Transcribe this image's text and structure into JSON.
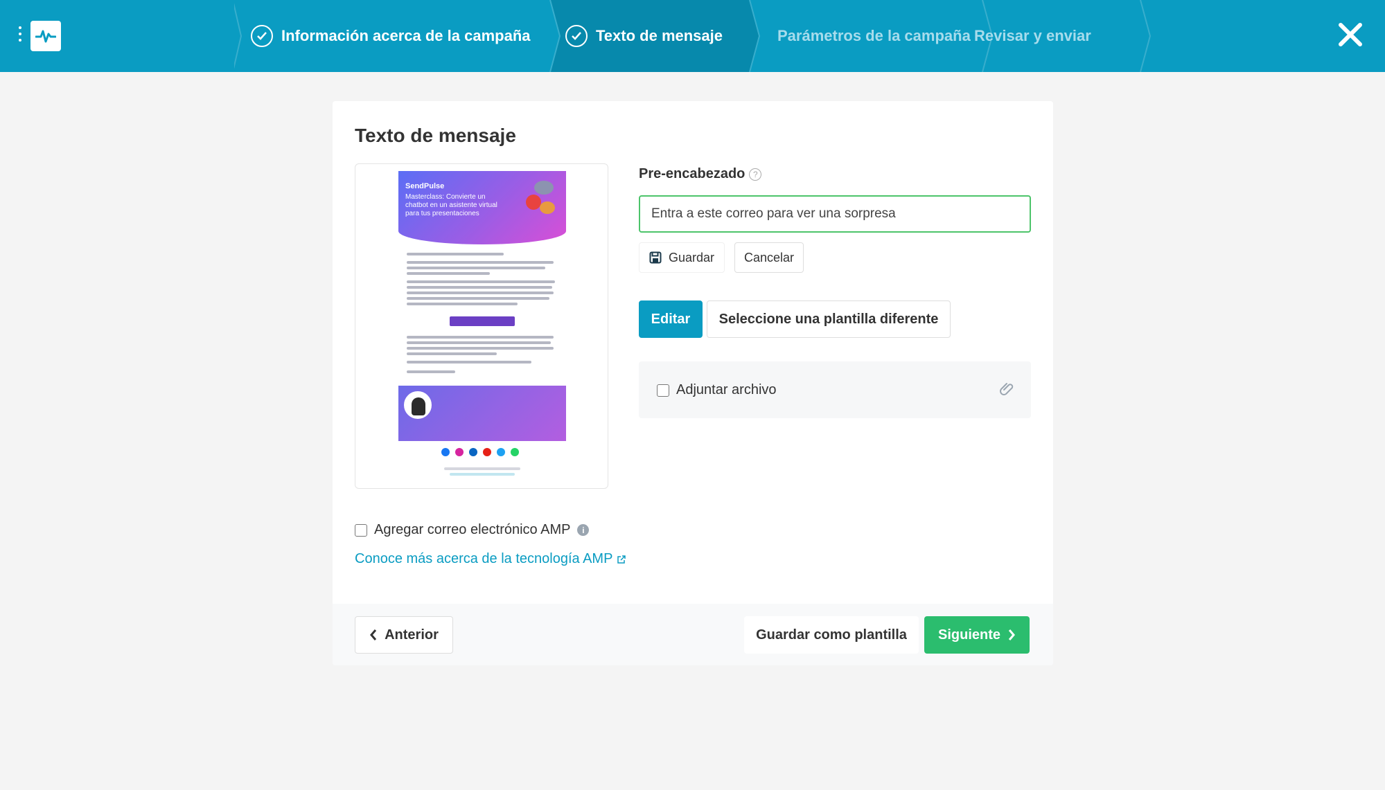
{
  "topbar": {
    "logo_icon": "pulse-logo-icon",
    "menu_icon": "vertical-dots-icon",
    "steps": [
      {
        "label": "Información acerca de la campaña",
        "state": "done"
      },
      {
        "label": "Texto de mensaje",
        "state": "active"
      },
      {
        "label": "Parámetros de la campaña",
        "state": "pending"
      },
      {
        "label": "Revisar y enviar",
        "state": "pending"
      }
    ],
    "close_icon": "close-icon"
  },
  "card": {
    "title": "Texto de mensaje",
    "preview": {
      "brand": "SendPulse",
      "headline": "Masterclass: Convierte un chatbot en un asistente virtual para tus presentaciones"
    },
    "preheader": {
      "label": "Pre-encabezado",
      "value": "Entra a este correo para ver una sorpresa",
      "save_label": "Guardar",
      "cancel_label": "Cancelar"
    },
    "edit_label": "Editar",
    "select_template_label": "Seleccione una plantilla diferente",
    "attach_label": "Adjuntar archivo",
    "amp_label": "Agregar correo electrónico AMP",
    "amp_link": "Conoce más acerca de la tecnología AMP"
  },
  "footer": {
    "prev_label": "Anterior",
    "save_template_label": "Guardar como plantilla",
    "next_label": "Siguiente"
  },
  "colors": {
    "brand": "#0a9cc2",
    "brand_dark": "#0789ac",
    "success": "#2bbd6e",
    "input_focus": "#4cc46a"
  }
}
